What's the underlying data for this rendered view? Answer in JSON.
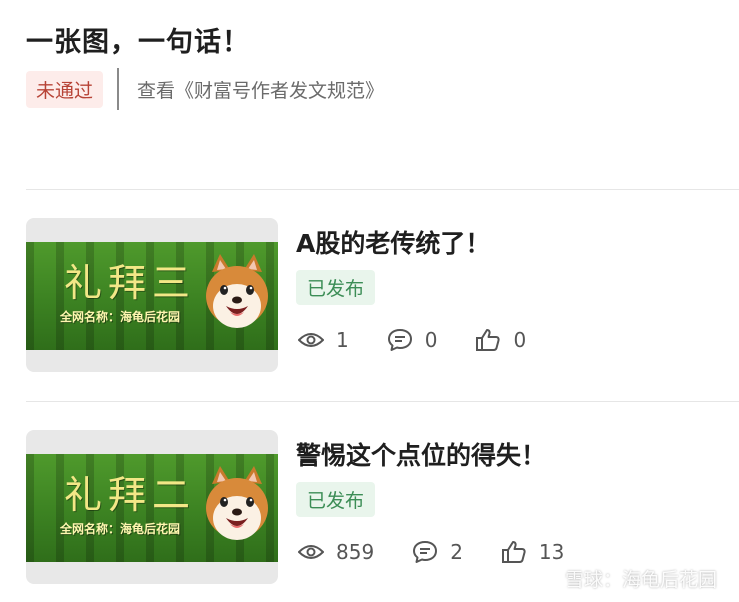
{
  "header": {
    "title": "一张图，一句话！",
    "status_badge": "未通过",
    "guideline_link": "查看《财富号作者发文规范》"
  },
  "posts": [
    {
      "thumbnail_title": "礼拜三",
      "thumbnail_subtitle": "全网名称：海龟后花园",
      "title": "A股的老传统了！",
      "status": "已发布",
      "views": "1",
      "comments": "0",
      "likes": "0"
    },
    {
      "thumbnail_title": "礼拜二",
      "thumbnail_subtitle": "全网名称：海龟后花园",
      "title": "警惕这个点位的得失！",
      "status": "已发布",
      "views": "859",
      "comments": "2",
      "likes": "13"
    }
  ],
  "watermark": {
    "text": "雪球：海龟后花园"
  },
  "icons": [
    "eye-icon",
    "comment-icon",
    "thumbs-up-icon",
    "snowball-logo-icon",
    "shiba-dog-image"
  ],
  "colors": {
    "rejected_bg": "#fdecea",
    "rejected_text": "#b74336",
    "published_bg": "#e9f5ec",
    "published_text": "#3c8d56"
  }
}
